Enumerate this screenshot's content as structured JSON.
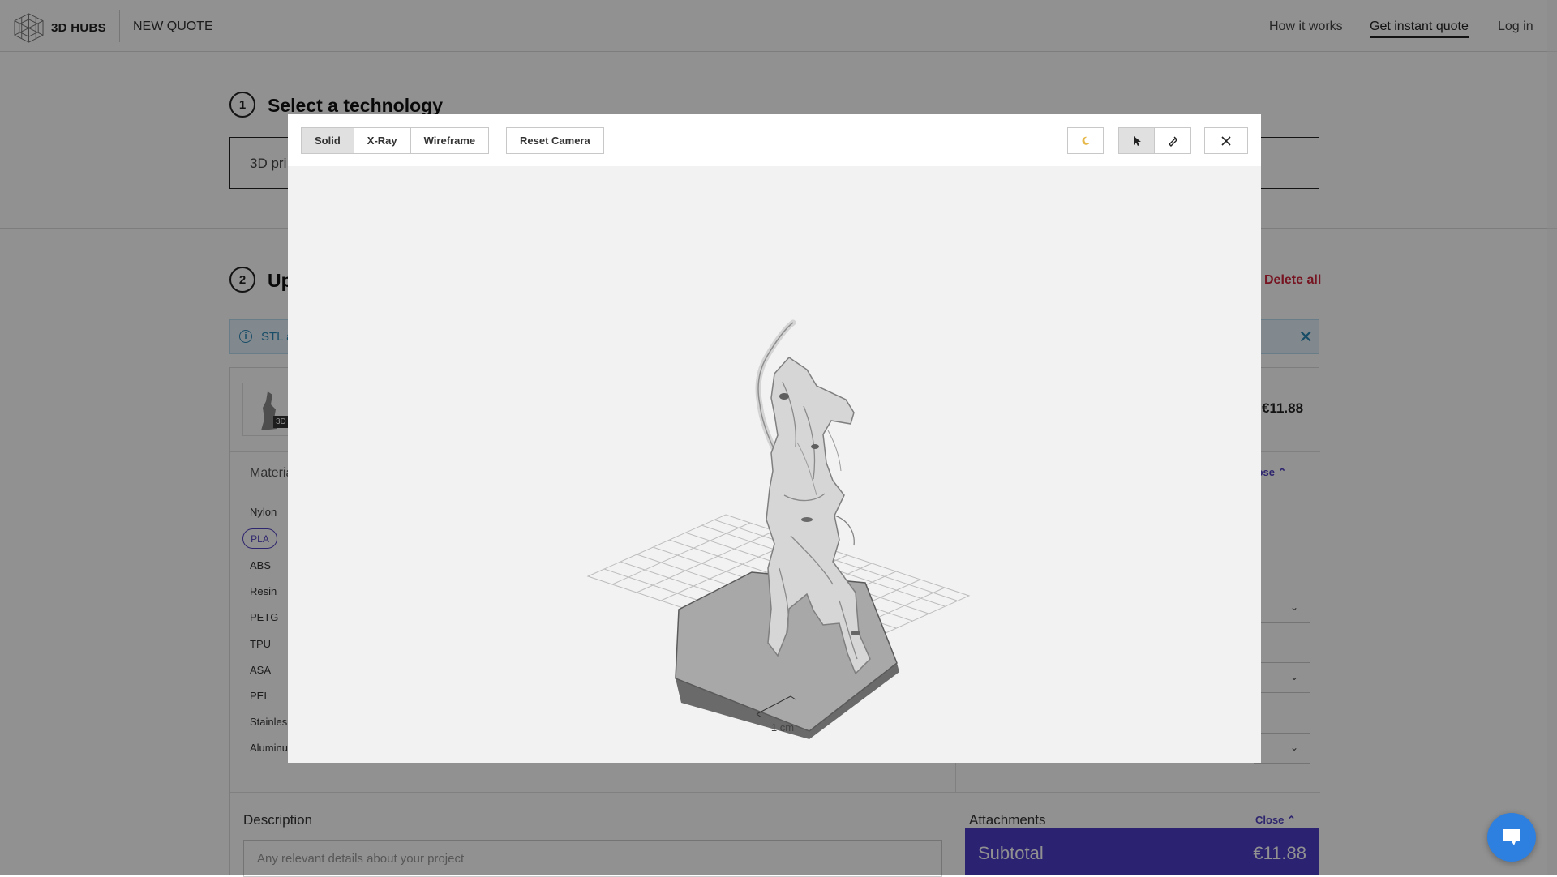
{
  "header": {
    "logo_text": "3D HUBS",
    "new_quote": "NEW QUOTE",
    "nav": {
      "how_it_works": "How it works",
      "get_quote": "Get instant quote",
      "login": "Log in"
    }
  },
  "steps": {
    "one": {
      "number": "1",
      "title": "Select a technology",
      "technology_value": "3D pri"
    },
    "two": {
      "number": "2",
      "title": "Up",
      "delete_all": "Delete all"
    }
  },
  "info_bar": {
    "text": "STL a",
    "close": "✕"
  },
  "part": {
    "thumb_badge": "3D",
    "price": "€11.88",
    "materials_label": "Materia",
    "materials": [
      "Nylon",
      "PLA",
      "ABS",
      "Resin",
      "PETG",
      "TPU",
      "ASA",
      "PEI",
      "Stainles",
      "Aluminu"
    ],
    "selected_material": "PLA",
    "close_label": "lose",
    "description_label": "Description",
    "description_placeholder": "Any relevant details about your project",
    "attachments_label": "Attachments",
    "attachments_close": "Close"
  },
  "subtotal": {
    "label": "Subtotal",
    "value": "€11.88"
  },
  "viewer": {
    "modes": [
      "Solid",
      "X-Ray",
      "Wireframe"
    ],
    "active_mode": "Solid",
    "reset_camera": "Reset Camera",
    "scale_label": "1 cm",
    "icons": {
      "theme": "moon-icon",
      "select": "cursor-icon",
      "measure": "ruler-icon",
      "close": "close-icon"
    },
    "active_tool": "select"
  },
  "colors": {
    "accent": "#4c3fc7",
    "danger": "#d0243a",
    "info": "#2b87b5",
    "chat": "#2d7fe0"
  }
}
